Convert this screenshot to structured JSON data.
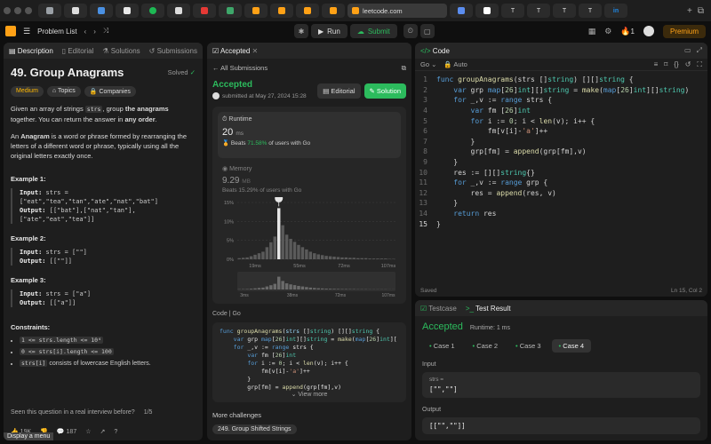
{
  "browser": {
    "url": "leetcode.com",
    "tabs": [
      "#9aa0a6",
      "#ddd",
      "#4a90e2",
      "#e8e8e8",
      "#1db954",
      "#ddd",
      "#e53935",
      "#3ea76a",
      "#ffa116",
      "#ffa116",
      "#ffa116",
      "#ffa116"
    ],
    "right_tabs": [
      "#5b8def",
      "#ffffff",
      "#ffffff",
      "#ffffff",
      "#ffffff",
      "#1e88e5",
      "#ffffff"
    ],
    "tab_letters": [
      "T",
      "T",
      "T",
      "T",
      "in"
    ]
  },
  "toolbar": {
    "problem_list": "Problem List",
    "run": "Run",
    "submit": "Submit",
    "streak": "1",
    "premium": "Premium"
  },
  "desc": {
    "tabs": [
      "Description",
      "Editorial",
      "Solutions",
      "Submissions"
    ],
    "title": "49. Group Anagrams",
    "solved": "Solved",
    "chips": [
      "Medium",
      "Topics",
      "Companies"
    ],
    "p1a": "Given an array of strings ",
    "p1code": "strs",
    "p1b": ", group ",
    "p1bold": "the anagrams",
    "p1c": " together. You can return the answer in ",
    "p1d": "any order",
    "p1e": ".",
    "p2a": "An ",
    "p2bold": "Anagram",
    "p2b": " is a word or phrase formed by rearranging the letters of a different word or phrase, typically using all the original letters exactly once.",
    "ex1_h": "Example 1:",
    "ex1_in_label": "Input:",
    "ex1_in": " strs =",
    "ex1_in2": "[\"eat\",\"tea\",\"tan\",\"ate\",\"nat\",\"bat\"]",
    "ex1_out_label": "Output:",
    "ex1_out": " [[\"bat\"],[\"nat\",\"tan\"],",
    "ex1_out2": "[\"ate\",\"eat\",\"tea\"]]",
    "ex2_h": "Example 2:",
    "ex2_in_label": "Input:",
    "ex2_in": " strs = [\"\"]",
    "ex2_out_label": "Output:",
    "ex2_out": " [[\"\"]]",
    "ex3_h": "Example 3:",
    "ex3_in_label": "Input:",
    "ex3_in": " strs = [\"a\"]",
    "ex3_out_label": "Output:",
    "ex3_out": " [[\"a\"]]",
    "cons_h": "Constraints:",
    "cons1": "1 <= strs.length <= 10⁴",
    "cons2": "0 <= strs[i].length <= 100",
    "cons3code": "strs[i]",
    "cons3": " consists of lowercase English letters.",
    "seen": "Seen this question in a real interview before?",
    "seen_pg": "1/5",
    "likes": "19K",
    "comments": "187",
    "tooltip": "Display a menu"
  },
  "accepted": {
    "tab": "Accepted",
    "all": "All Submissions",
    "title": "Accepted",
    "submitted": "submitted at May 27, 2024 15:28",
    "editorial": "Editorial",
    "solution": "Solution",
    "runtime_label": "Runtime",
    "runtime_val": "20",
    "runtime_unit": "ms",
    "beats_label": "Beats",
    "beats_pct": "71.58%",
    "beats_tail": "of users with Go",
    "mem_label": "Memory",
    "mem_val": "9.29",
    "mem_unit": "MB",
    "mem_beats": "Beats 15.29% of users with Go",
    "code_label": "Code",
    "code_lang": "Go",
    "view_more": "View more",
    "more_challenges": "More challenges",
    "challenge_chip": "249. Group Shifted Strings"
  },
  "chart_data": {
    "type": "bar",
    "y_ticks": [
      "15%",
      "10%",
      "5%",
      "0%"
    ],
    "x_ticks": [
      "19ms",
      "55ms",
      "72ms",
      "107ms"
    ],
    "mini_ticks": [
      "3ms",
      "38ms",
      "72ms",
      "107ms"
    ],
    "values": [
      0.3,
      0.4,
      0.5,
      0.8,
      1.2,
      1.6,
      2.0,
      3.2,
      4.5,
      6.0,
      13.5,
      9.0,
      6.5,
      5.4,
      4.6,
      3.8,
      3.2,
      2.6,
      2.0,
      1.6,
      1.3,
      1.1,
      0.9,
      0.8,
      0.7,
      0.6,
      0.5,
      0.5,
      0.4,
      0.4,
      0.3,
      0.3,
      0.3,
      0.2,
      0.2,
      0.2,
      0.2,
      0.2,
      0.1,
      0.1
    ],
    "highlight_index": 10,
    "ylim": [
      0,
      15
    ]
  },
  "editor": {
    "title": "Code",
    "lang": "Go",
    "mode": "Auto",
    "saved": "Saved",
    "pos": "Ln 15, Col 2"
  },
  "testcase": {
    "tab1": "Testcase",
    "tab2": "Test Result",
    "accepted": "Accepted",
    "runtime": "Runtime: 1 ms",
    "cases": [
      "Case 1",
      "Case 2",
      "Case 3",
      "Case 4"
    ],
    "input": "Input",
    "var": "strs =",
    "in_val": "[\"\",\"\"]",
    "output": "Output",
    "out_val": "[[\"\",\"\"]]"
  }
}
